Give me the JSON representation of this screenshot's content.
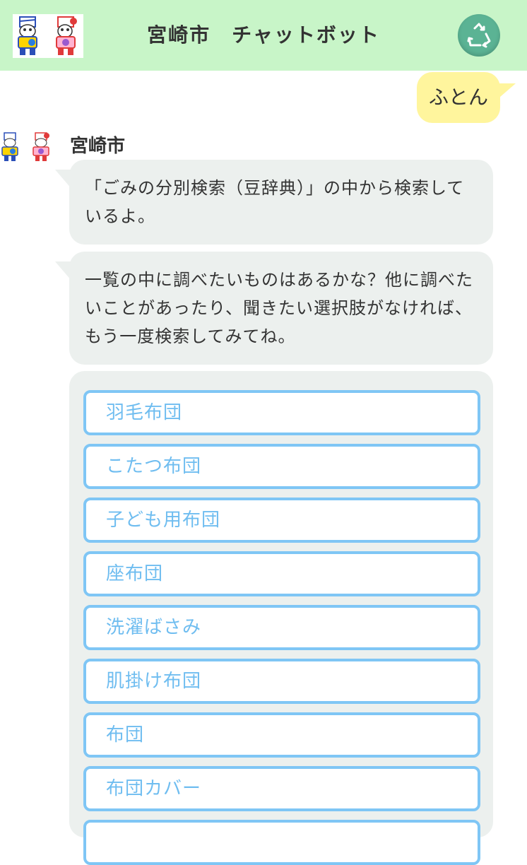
{
  "header": {
    "title": "宮崎市　チャットボット",
    "mascot_icon": "mascot-logo-icon",
    "recycle_icon": "recycle-icon"
  },
  "colors": {
    "header_bg": "#c8f5c8",
    "user_bubble": "#fff59d",
    "bot_bubble": "#ecf0ee",
    "option_border": "#7fc6f5",
    "option_text": "#6fbdf0",
    "recycle_button": "#5bb394"
  },
  "chat": {
    "user_message": "ふとん",
    "bot_name": "宮崎市",
    "bot_message_1": "「ごみの分別検索（豆辞典）」の中から検索しているよ。",
    "bot_message_2": "一覧の中に調べたいものはあるかな？他に調べたいことがあったり、聞きたい選択肢がなければ、もう一度検索してみてね。"
  },
  "options": [
    "羽毛布団",
    "こたつ布団",
    "子ども用布団",
    "座布団",
    "洗濯ばさみ",
    "肌掛け布団",
    "布団",
    "布団カバー"
  ]
}
